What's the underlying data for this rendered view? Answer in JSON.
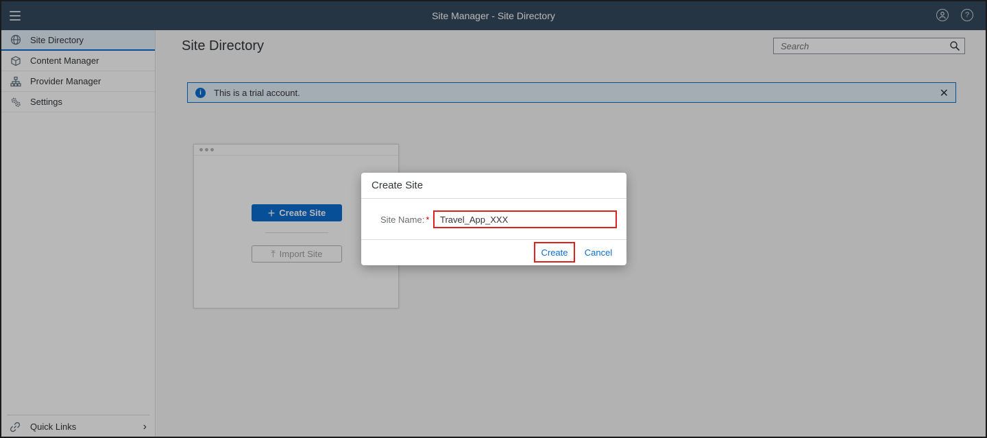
{
  "shell": {
    "title": "Site Manager - Site Directory",
    "left_icon": "menu-icon",
    "right_icons": [
      "user-icon",
      "help-icon"
    ]
  },
  "sidebar": {
    "items": [
      {
        "label": "Site Directory",
        "icon": "globe-icon",
        "active": true
      },
      {
        "label": "Content Manager",
        "icon": "cube-icon",
        "active": false
      },
      {
        "label": "Provider Manager",
        "icon": "org-chart-icon",
        "active": false
      },
      {
        "label": "Settings",
        "icon": "gears-icon",
        "active": false
      }
    ],
    "quick_links": {
      "label": "Quick Links",
      "icon": "link-icon"
    }
  },
  "main": {
    "title": "Site Directory",
    "search": {
      "placeholder": "Search",
      "value": ""
    },
    "message": {
      "text": "This is a trial account.",
      "icon": "info-icon"
    },
    "card": {
      "create_label": "Create Site",
      "import_label": "Import Site"
    }
  },
  "dialog": {
    "title": "Create Site",
    "field_label": "Site Name:",
    "required_mark": "*",
    "field_value": "Travel_App_XXX",
    "create_label": "Create",
    "cancel_label": "Cancel"
  },
  "colors": {
    "shell_bg": "#354a5f",
    "accent": "#0a6ed1",
    "highlight_border": "#e0201b"
  }
}
